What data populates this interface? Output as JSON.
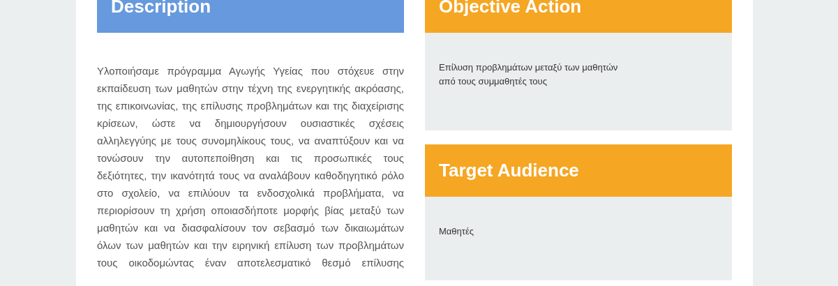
{
  "description": {
    "title": "Description",
    "text": "Υλοποιήσαμε πρόγραμμα Αγωγής Υγείας που στόχευε στην εκπαίδευση των μαθητών στην τέχνη της ενεργητικής ακρόασης, της επικοινωνίας, της επίλυσης προβλημάτων και της διαχείρισης κρίσεων, ώστε να δημιουργήσουν ουσιαστικές σχέσεις αλληλεγγύης με τους συνομηλίκους τους, να αναπτύξουν και να τονώσουν την αυτοπεποίθηση και τις προσωπικές τους δεξιότητες, την ικανότητά τους να αναλάβουν καθοδηγητικό ρόλο στο σχολείο, να επιλύουν τα ενδοσχολικά προβλήματα, να περιορίσουν τη χρήση οποιασδήποτε μορφής βίας μεταξύ των μαθητών και να διασφαλίσουν τον σεβασμό των δικαιωμάτων όλων των μαθητών και την ειρηνική επίλυση των προβλημάτων τους οικοδομώντας έναν αποτελεσματικό θεσμό επίλυσης"
  },
  "cards": [
    {
      "title": "Objective Action",
      "color": "#f5a623",
      "lines": [
        "Επίλυση προβλημάτων μεταξύ των μαθητών",
        "από τους συμμαθητές τους"
      ]
    },
    {
      "title": "Target Audience",
      "color": "#f5a623",
      "lines": [
        "Μαθητές"
      ]
    }
  ]
}
